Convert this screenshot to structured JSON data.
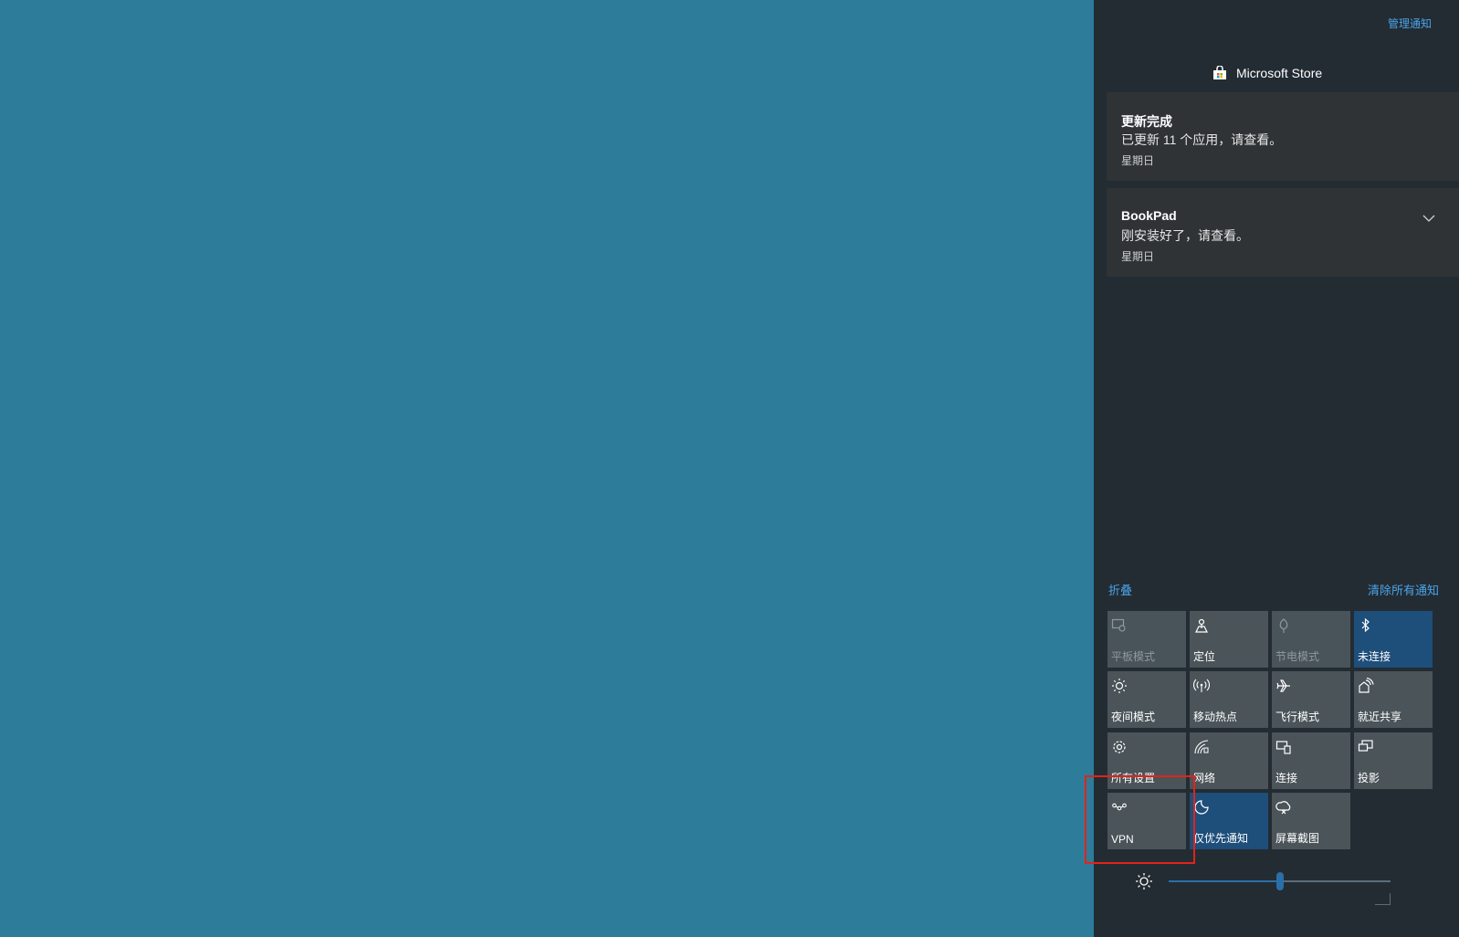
{
  "action_center": {
    "manage_notifications": "管理通知",
    "app_name": "Microsoft Store",
    "notifications": [
      {
        "title": "更新完成",
        "body": "已更新 11 个应用，请查看。",
        "time": "星期日"
      },
      {
        "title": "BookPad",
        "body": "刚安装好了，请查看。",
        "time": "星期日"
      }
    ],
    "collapse_label": "折叠",
    "clear_all_label": "清除所有通知",
    "tiles": [
      {
        "label": "平板模式",
        "icon": "tablet-mode-icon",
        "state": "disabled"
      },
      {
        "label": "定位",
        "icon": "location-icon",
        "state": "normal"
      },
      {
        "label": "节电模式",
        "icon": "battery-saver-icon",
        "state": "disabled"
      },
      {
        "label": "未连接",
        "icon": "bluetooth-icon",
        "state": "active"
      },
      {
        "label": "夜间模式",
        "icon": "night-light-icon",
        "state": "normal"
      },
      {
        "label": "移动热点",
        "icon": "mobile-hotspot-icon",
        "state": "normal"
      },
      {
        "label": "飞行模式",
        "icon": "airplane-mode-icon",
        "state": "normal"
      },
      {
        "label": "就近共享",
        "icon": "nearby-sharing-icon",
        "state": "normal"
      },
      {
        "label": "所有设置",
        "icon": "settings-icon",
        "state": "normal"
      },
      {
        "label": "网络",
        "icon": "network-icon",
        "state": "normal"
      },
      {
        "label": "连接",
        "icon": "connect-icon",
        "state": "normal"
      },
      {
        "label": "投影",
        "icon": "project-icon",
        "state": "normal"
      },
      {
        "label": "VPN",
        "icon": "vpn-icon",
        "state": "normal"
      },
      {
        "label": "仅优先通知",
        "icon": "focus-assist-icon",
        "state": "active"
      },
      {
        "label": "屏幕截图",
        "icon": "screen-snip-icon",
        "state": "normal"
      }
    ],
    "brightness": {
      "icon": "brightness-icon",
      "level": 0.5
    }
  },
  "colors": {
    "desktop": "#2d7c9a",
    "panel": "#232c33",
    "tile": "#4a5459",
    "tile_active": "#1e4e7a",
    "link": "#4aa3e8",
    "highlight": "#e2231a"
  }
}
